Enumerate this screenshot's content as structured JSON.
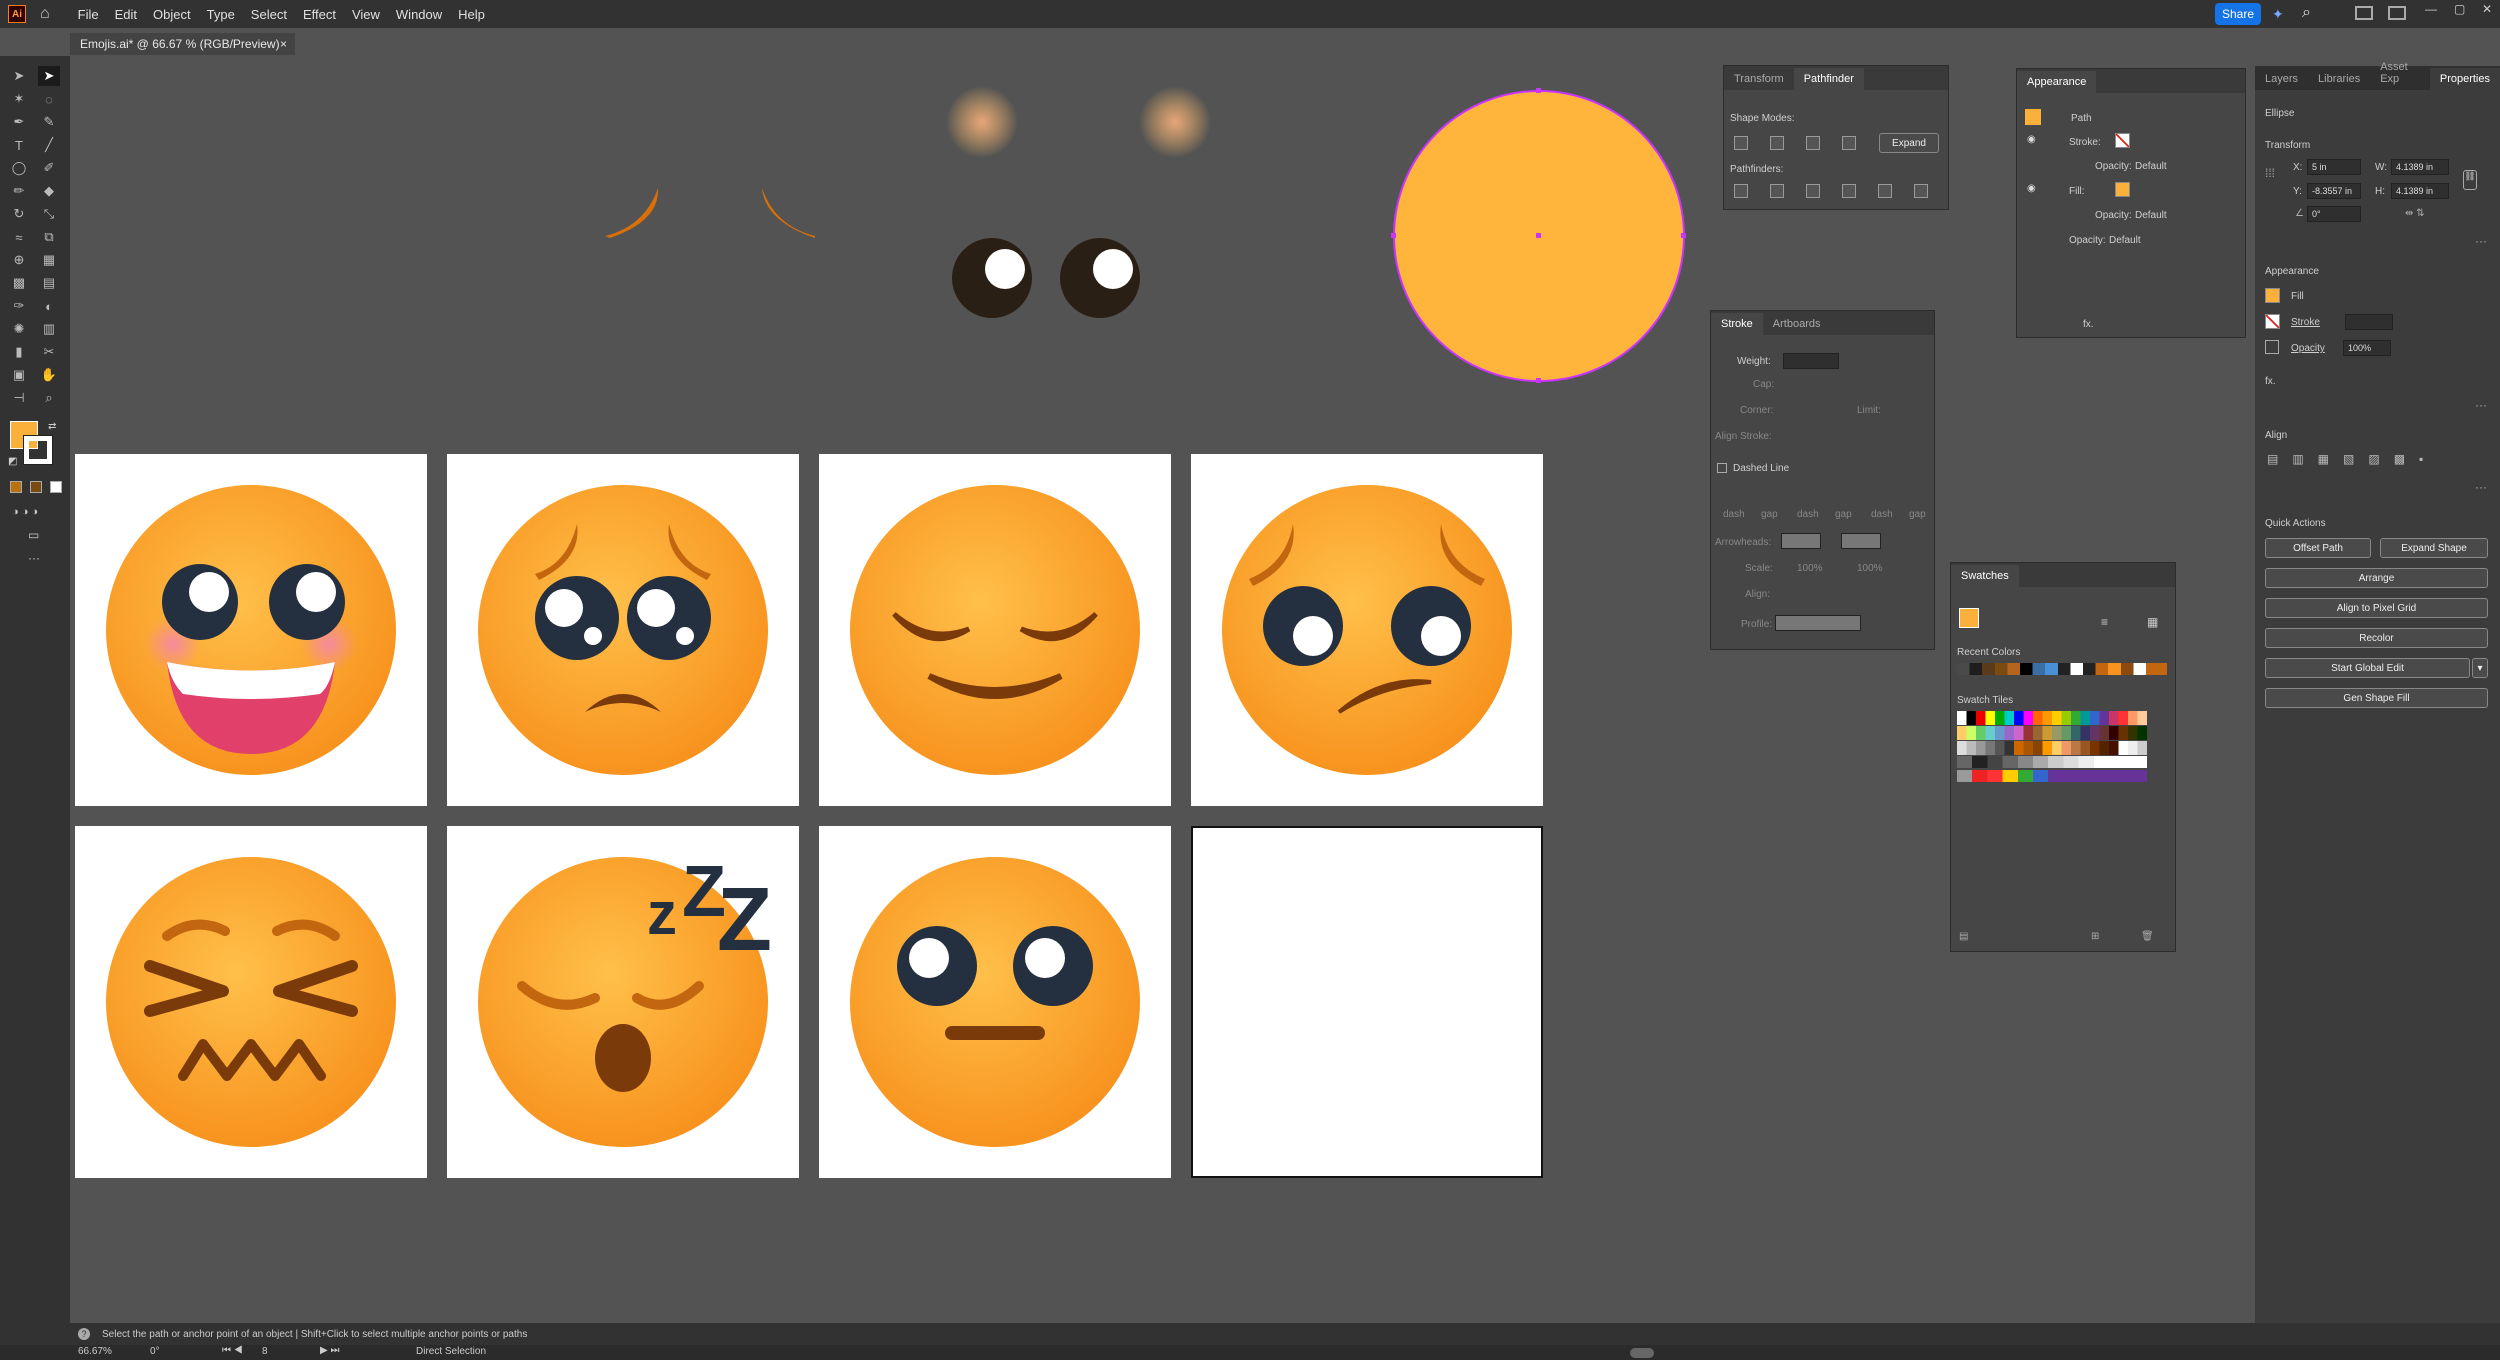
{
  "menubar": {
    "logo": "Ai",
    "items": [
      "File",
      "Edit",
      "Object",
      "Type",
      "Select",
      "Effect",
      "View",
      "Window",
      "Help"
    ],
    "share": "Share"
  },
  "document": {
    "tab_title": "Emojis.ai* @ 66.67 % (RGB/Preview)",
    "close": "×"
  },
  "colors": {
    "face": "#fbb03b",
    "face_dark": "#f7931e",
    "eye": "#2a1f15",
    "brow": "#c2660f",
    "selection": "#cc33ff",
    "pupil_dark": "#24303f"
  },
  "pathfinder": {
    "tabs": [
      "Transform",
      "Pathfinder"
    ],
    "shape_modes": "Shape Modes:",
    "expand": "Expand",
    "pathfinders": "Pathfinders:"
  },
  "stroke": {
    "tabs": [
      "Stroke",
      "Artboards"
    ],
    "weight": "Weight:",
    "cap": "Cap:",
    "corner": "Corner:",
    "limit": "Limit:",
    "align": "Align Stroke:",
    "dashed": "Dashed Line",
    "dash_labels": [
      "dash",
      "gap",
      "dash",
      "gap",
      "dash",
      "gap"
    ],
    "arrowheads": "Arrowheads:",
    "scale": "Scale:",
    "scale_values": [
      "100%",
      "100%"
    ],
    "align2": "Align:",
    "profile": "Profile:"
  },
  "appearance": {
    "tab": "Appearance",
    "path": "Path",
    "stroke": "Stroke:",
    "opacity": "Opacity:",
    "opacity_value": "Default",
    "fill": "Fill:",
    "fx": "fx."
  },
  "swatches": {
    "tab": "Swatches",
    "recent": "Recent Colors",
    "tiles": "Swatch Tiles"
  },
  "properties": {
    "tabs": [
      "Layers",
      "Libraries",
      "Asset Exp",
      "Properties"
    ],
    "object": "Ellipse",
    "transform": "Transform",
    "x_label": "X:",
    "x": "5 in",
    "y_label": "Y:",
    "y": "-8.3557 in",
    "w_label": "W:",
    "w": "4.1389 in",
    "h_label": "H:",
    "h": "4.1389 in",
    "angle": "0°",
    "appearance": "Appearance",
    "fill": "Fill",
    "stroke": "Stroke",
    "opacity": "Opacity",
    "opacity_value": "100%",
    "fx": "fx.",
    "align": "Align",
    "quick_actions": "Quick Actions",
    "buttons": {
      "offset": "Offset Path",
      "expand": "Expand Shape",
      "arrange": "Arrange",
      "pixel": "Align to Pixel Grid",
      "recolor": "Recolor",
      "global": "Start Global Edit",
      "gen": "Gen Shape Fill"
    }
  },
  "status": {
    "hint": "Select the path or anchor point of an object  |  Shift+Click to select multiple anchor points or paths",
    "zoom": "66.67%",
    "rotate": "0°",
    "artboard": "8",
    "tool": "Direct Selection"
  },
  "icons": {
    "home": "home-icon",
    "search": "search-icon",
    "direct": "direct-selection-icon"
  }
}
